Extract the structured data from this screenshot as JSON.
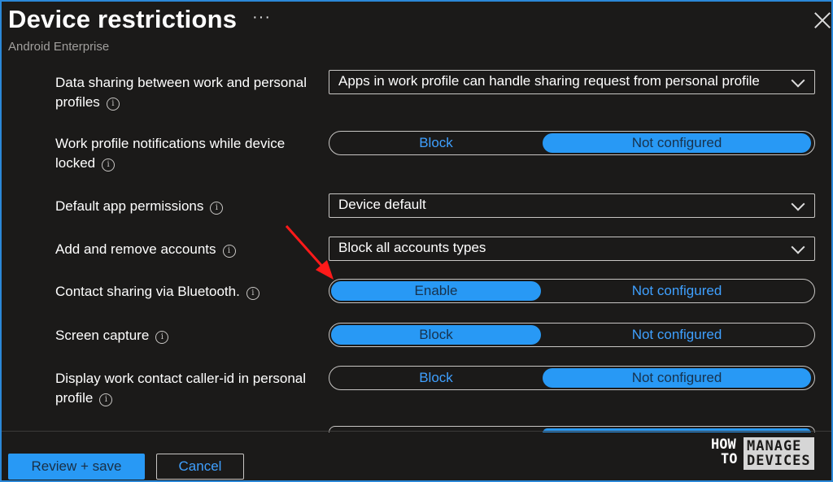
{
  "header": {
    "title": "Device restrictions",
    "more": "···",
    "subtitle": "Android Enterprise"
  },
  "settings": [
    {
      "label_line1": "Data sharing between work and personal",
      "label_line2": "profiles",
      "value": "Apps in work profile can handle sharing request from personal profile"
    },
    {
      "label_line1": "Work profile notifications while device",
      "label_line2": "locked",
      "left": "Block",
      "right": "Not configured",
      "selected": "right"
    },
    {
      "label_line1": "Default app permissions",
      "value": "Device default"
    },
    {
      "label_line1": "Add and remove accounts",
      "value": "Block all accounts types"
    },
    {
      "label_line1": "Contact sharing via Bluetooth.",
      "left": "Enable",
      "right": "Not configured",
      "selected": "left"
    },
    {
      "label_line1": "Screen capture",
      "left": "Block",
      "right": "Not configured",
      "selected": "left"
    },
    {
      "label_line1": "Display work contact caller-id in personal",
      "label_line2": "profile",
      "left": "Block",
      "right": "Not configured",
      "selected": "right"
    }
  ],
  "info_glyph": "i",
  "footer": {
    "review_save": "Review + save",
    "cancel": "Cancel"
  },
  "logo": {
    "how": "HOW",
    "to": "TO",
    "manage": "MANAGE",
    "devices": "DEVICES"
  },
  "colors": {
    "accent": "#2899f5",
    "link": "#3fa0ff",
    "background": "#1b1a19",
    "arrow": "#ff1a1a"
  }
}
